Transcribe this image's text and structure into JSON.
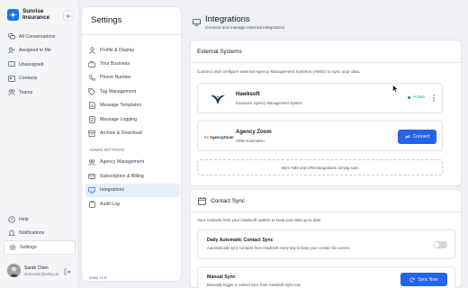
{
  "brand": {
    "name_line1": "Sunrise",
    "name_line2": "Insurance"
  },
  "nav": {
    "items": [
      {
        "label": "All Conversations",
        "icon": "chat-bubbles-icon"
      },
      {
        "label": "Assigned to Me",
        "icon": "user-check-icon"
      },
      {
        "label": "Unassigned",
        "icon": "message-square-icon"
      },
      {
        "label": "Contacts",
        "icon": "contact-card-icon"
      },
      {
        "label": "Teams",
        "icon": "users-icon"
      }
    ],
    "bottom": [
      {
        "label": "Help",
        "icon": "help-circle-icon"
      },
      {
        "label": "Notifications",
        "icon": "bell-icon"
      },
      {
        "label": "Settings",
        "icon": "gear-icon"
      }
    ]
  },
  "user": {
    "name": "Sarah Chen",
    "email": "demouser@voley.us"
  },
  "settings": {
    "title": "Settings",
    "items": [
      {
        "label": "Profile & Display",
        "icon": "person-icon"
      },
      {
        "label": "Your Business",
        "icon": "briefcase-icon"
      },
      {
        "label": "Phone Number",
        "icon": "phone-icon"
      },
      {
        "label": "Tag Management",
        "icon": "tag-icon"
      },
      {
        "label": "Message Templates",
        "icon": "document-icon"
      },
      {
        "label": "Message Logging",
        "icon": "log-icon"
      },
      {
        "label": "Archive & Download",
        "icon": "archive-icon"
      }
    ],
    "admin_heading": "ADMIN SETTINGS",
    "admin_items": [
      {
        "label": "Agency Management",
        "icon": "people-icon"
      },
      {
        "label": "Subscription & Billing",
        "icon": "credit-card-icon"
      },
      {
        "label": "Integrations",
        "icon": "plug-icon"
      },
      {
        "label": "Audit Log",
        "icon": "clipboard-icon"
      }
    ],
    "version": "Voley v1.0"
  },
  "page": {
    "title": "Integrations",
    "subtitle": "Connect and manage external integrations"
  },
  "external": {
    "title": "External Systems",
    "description": "Connect and configure external Agency Management Systems (AMSs) to sync your data.",
    "integrations": [
      {
        "name": "Hawksoft",
        "description": "Insurance Agency Management System",
        "status": "Active",
        "logo": "hawk-logo"
      },
      {
        "name": "Agency Zoom",
        "description": "CRM Automation",
        "button": "Connect",
        "logo_text_a": "AZ",
        "logo_text_b": "AgencyZoom"
      }
    ],
    "more_note": "More AMS and CRM integrations coming soon"
  },
  "sync": {
    "title": "Contact Sync",
    "description": "Sync contacts from your Hawksoft system to keep your data up to date.",
    "daily_title": "Daily Automatic Contact Sync",
    "daily_desc": "Automatically sync contacts from Hawksoft every day to keep your contact list current.",
    "daily_enabled": false,
    "manual_title": "Manual Sync",
    "manual_desc": "Manually trigger a contact sync from Hawksoft right now.",
    "sync_button": "Sync Now"
  },
  "colors": {
    "accent": "#2563eb",
    "active": "#16a34a"
  }
}
